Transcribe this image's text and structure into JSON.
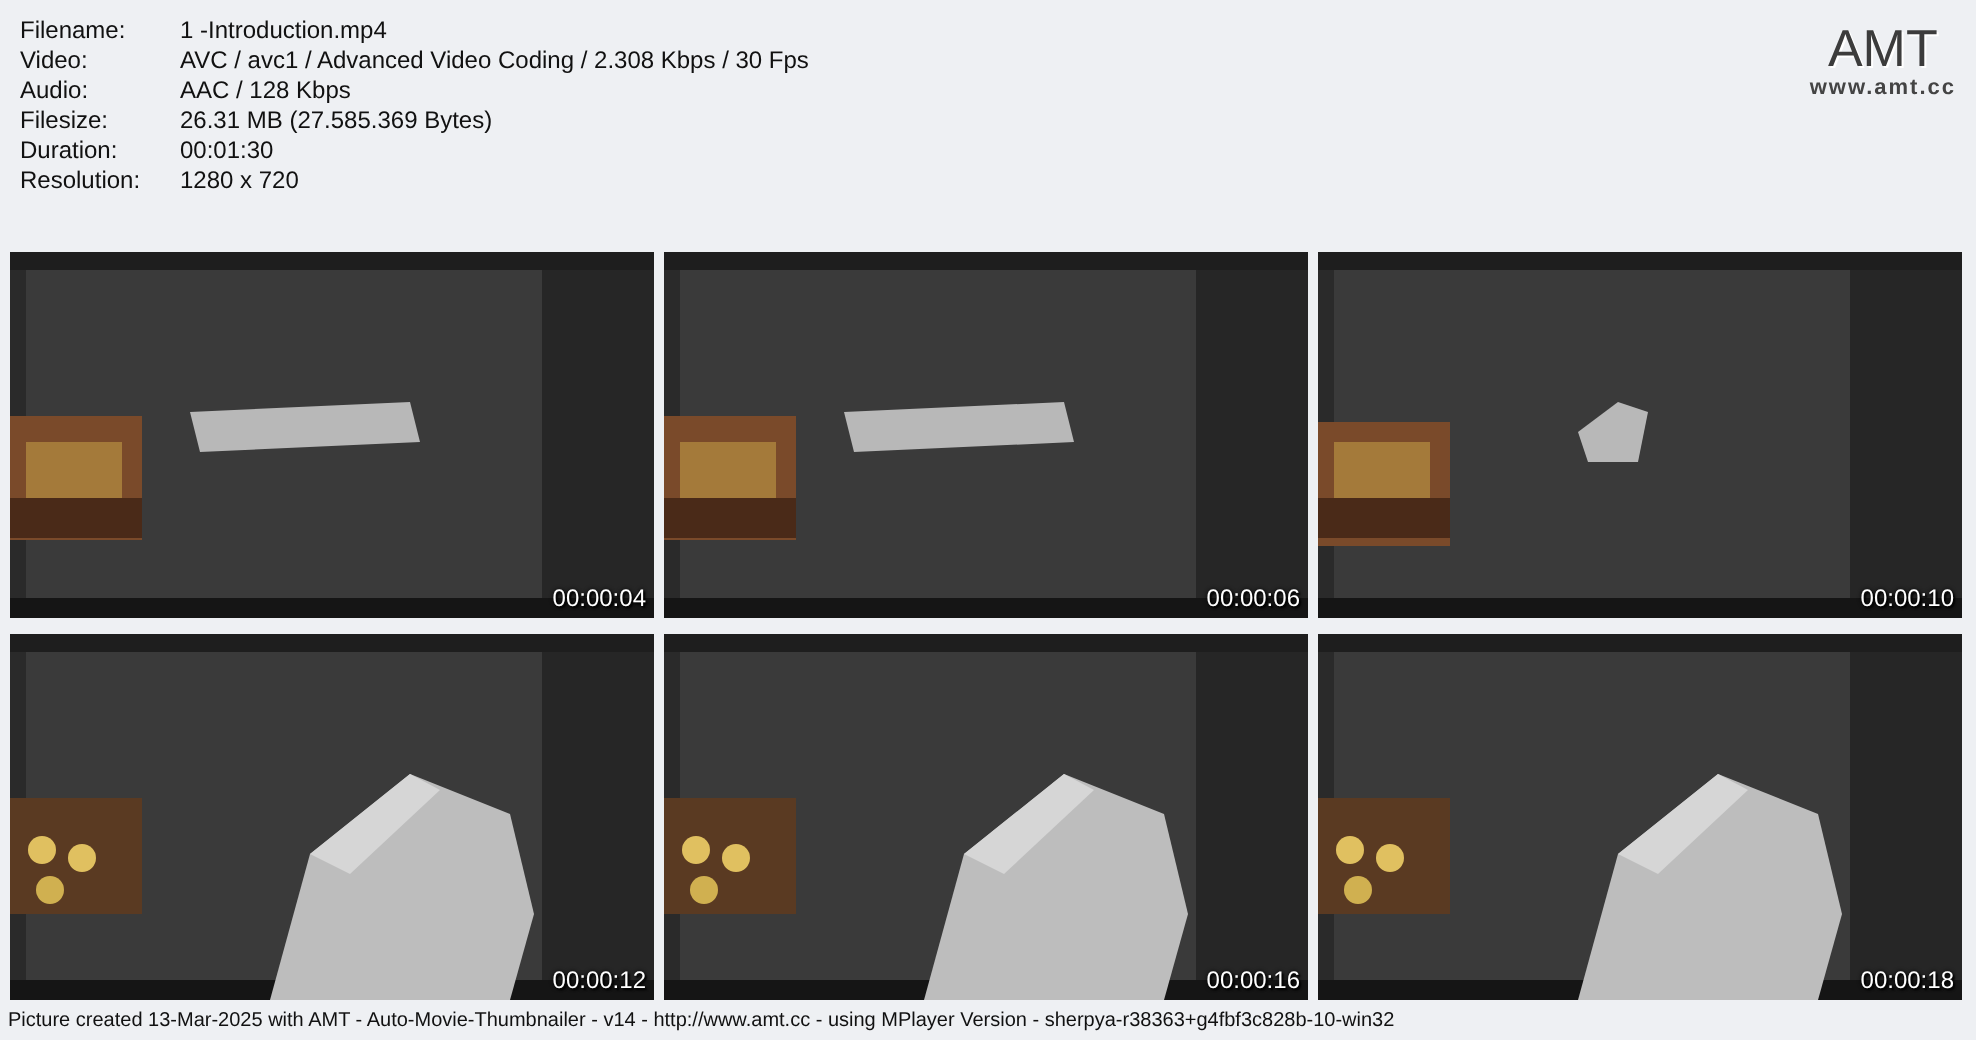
{
  "info": [
    {
      "label": "Filename:",
      "value": "1 -Introduction.mp4"
    },
    {
      "label": "Video:",
      "value": "AVC / avc1 / Advanced Video Coding / 2.308 Kbps / 30 Fps"
    },
    {
      "label": "Audio:",
      "value": "AAC / 128 Kbps"
    },
    {
      "label": "Filesize:",
      "value": "26.31 MB (27.585.369 Bytes)"
    },
    {
      "label": "Duration:",
      "value": "00:01:30"
    },
    {
      "label": "Resolution:",
      "value": "1280 x 720"
    }
  ],
  "logo": {
    "title": "AMT",
    "url": "www.amt.cc"
  },
  "frames": [
    {
      "kind": "picture",
      "time": "00:00:04"
    },
    {
      "kind": "picture",
      "time": "00:00:06"
    },
    {
      "kind": "picture",
      "time": "00:00:10"
    },
    {
      "kind": "picture",
      "time": "00:00:12"
    },
    {
      "kind": "picture",
      "time": "00:00:16"
    },
    {
      "kind": "picture",
      "time": "00:00:18"
    }
  ],
  "footer": "Picture created 13-Mar-2025 with AMT - Auto-Movie-Thumbnailer - v14 - http://www.amt.cc - using MPlayer Version - sherpya-r38363+g4fbf3c828b-10-win32"
}
